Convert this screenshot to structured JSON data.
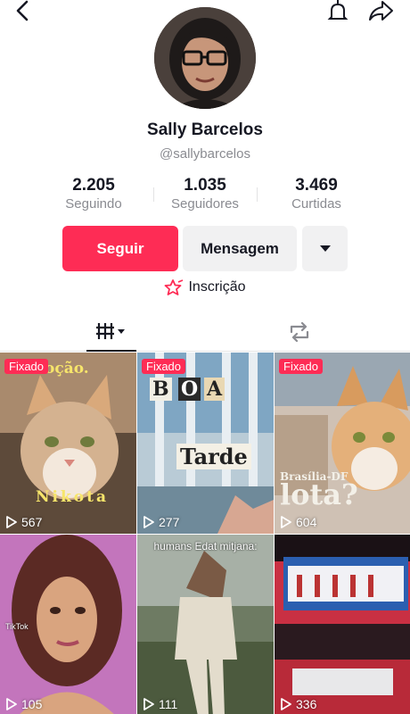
{
  "topbar": {
    "back_icon": "chevron-left-icon",
    "bell_icon": "bell-icon",
    "share_icon": "share-arrow-icon"
  },
  "profile": {
    "name": "Sally Barcelos",
    "handle": "@sallybarcelos"
  },
  "stats": [
    {
      "value": "2.205",
      "label": "Seguindo"
    },
    {
      "value": "1.035",
      "label": "Seguidores"
    },
    {
      "value": "3.469",
      "label": "Curtidas"
    }
  ],
  "actions": {
    "follow": "Seguir",
    "message": "Mensagem"
  },
  "subscription": {
    "label": "Inscrição"
  },
  "colors": {
    "accent": "#fe2c55",
    "button_bg": "#f1f1f2",
    "muted": "#8a8b91"
  },
  "videos": [
    {
      "pinned_label": "Fixado",
      "views": "567",
      "overlay": [
        "oção.",
        "Nikota"
      ]
    },
    {
      "pinned_label": "Fixado",
      "views": "277",
      "overlay": [
        "B",
        "O",
        "A",
        "Tarde"
      ]
    },
    {
      "pinned_label": "Fixado",
      "views": "604",
      "overlay": [
        "Brasília-DF",
        "lota?"
      ]
    },
    {
      "views": "105",
      "overlay": [
        "TikTok"
      ]
    },
    {
      "views": "111",
      "caption": "humans Edat mitjana:"
    },
    {
      "views": "336"
    }
  ]
}
